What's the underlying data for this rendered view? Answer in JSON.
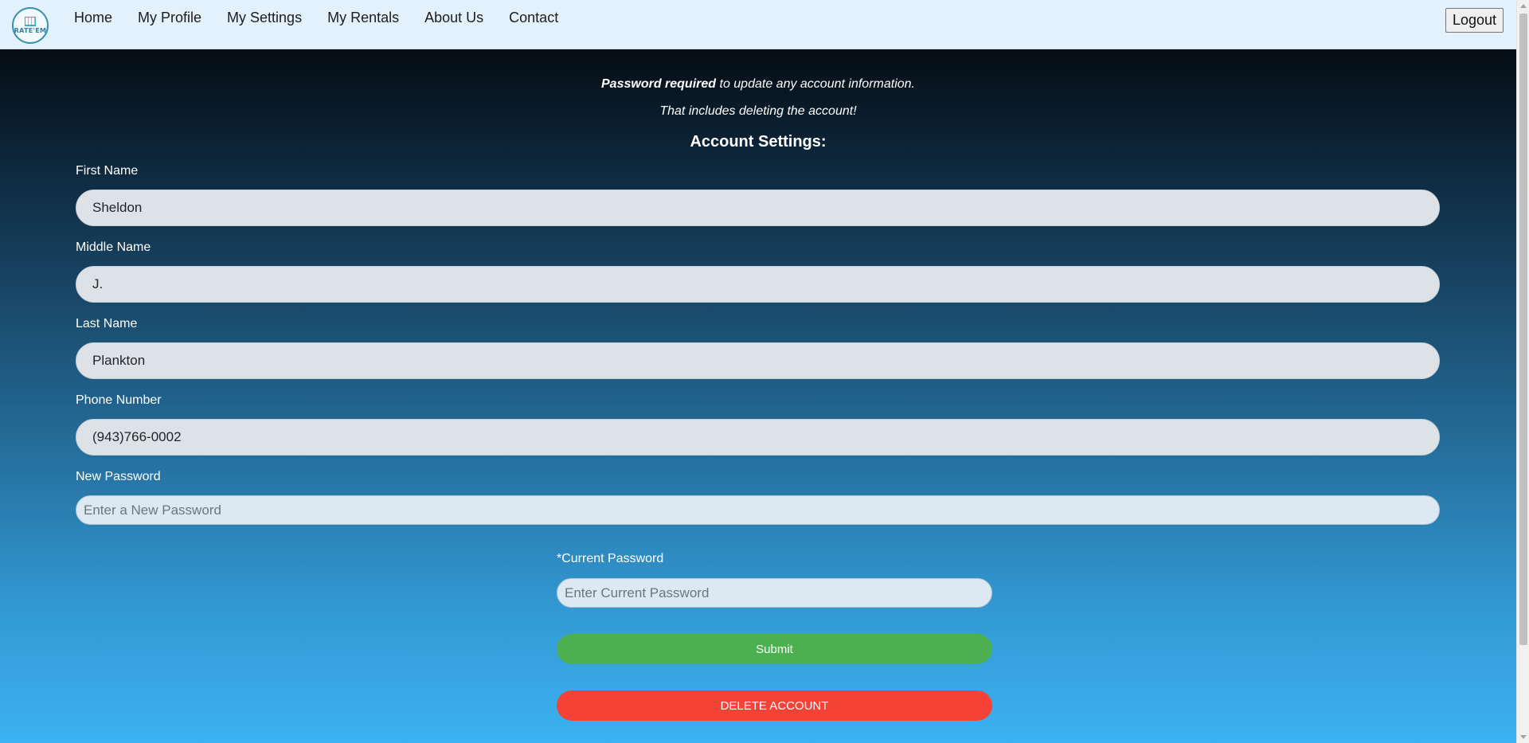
{
  "nav": {
    "logo_text": "RATE'EM",
    "links": [
      "Home",
      "My Profile",
      "My Settings",
      "My Rentals",
      "About Us",
      "Contact"
    ],
    "logout_label": "Logout"
  },
  "notice": {
    "line1_bold": "Password required",
    "line1_rest": " to update any account information.",
    "line2": "That includes deleting the account!"
  },
  "form": {
    "heading": "Account Settings:",
    "first_name": {
      "label": "First Name",
      "value": "Sheldon"
    },
    "middle_name": {
      "label": "Middle Name",
      "value": "J."
    },
    "last_name": {
      "label": "Last Name",
      "value": "Plankton"
    },
    "phone": {
      "label": "Phone Number",
      "value": "(943)766-0002"
    },
    "new_password": {
      "label": "New Password",
      "placeholder": "Enter a New Password"
    },
    "current_password": {
      "label": "*Current Password",
      "placeholder": "Enter Current Password"
    },
    "submit_label": "Submit",
    "delete_label": "DELETE ACCOUNT"
  },
  "colors": {
    "navbar_bg": "#e3f1fd",
    "submit": "#4caf50",
    "delete": "#f44336",
    "gradient_top": "#050d14",
    "gradient_bottom": "#3cb2f2"
  }
}
